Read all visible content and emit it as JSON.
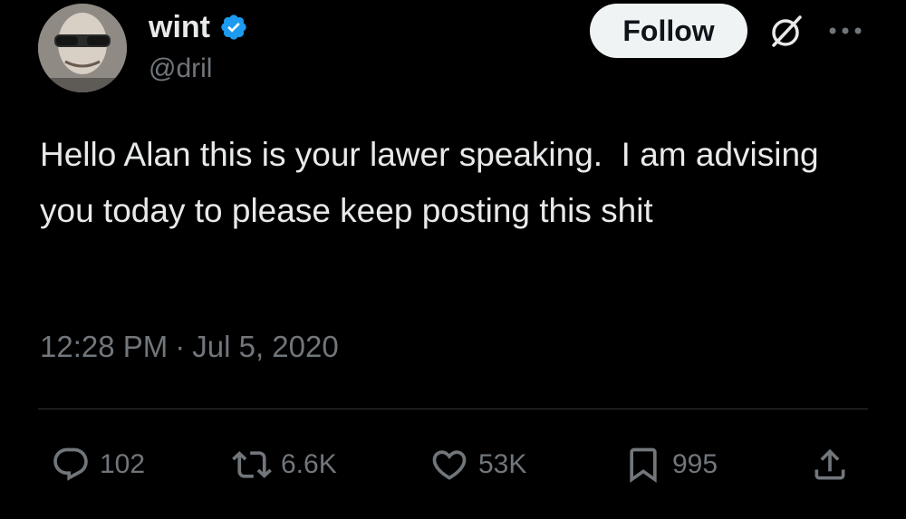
{
  "author": {
    "display_name": "wint",
    "handle": "@dril",
    "verified": true
  },
  "header": {
    "follow_label": "Follow"
  },
  "icons": {
    "verified": "verified-badge-icon",
    "grok": "grok-icon",
    "more": "more-icon",
    "reply": "reply-icon",
    "repost": "repost-icon",
    "like": "like-icon",
    "bookmark": "bookmark-icon",
    "share": "share-icon"
  },
  "tweet": {
    "text": "Hello Alan this is your lawer speaking.  I am advising you today to please keep posting this shit",
    "time": "12:28 PM",
    "separator": "·",
    "date": "Jul 5, 2020"
  },
  "actions": {
    "replies": "102",
    "reposts": "6.6K",
    "likes": "53K",
    "bookmarks": "995"
  },
  "colors": {
    "background": "#000000",
    "text": "#e7e9ea",
    "secondary": "#71767b",
    "verified": "#1d9bf0",
    "follow_bg": "#eff3f4",
    "divider": "#2f3336"
  }
}
